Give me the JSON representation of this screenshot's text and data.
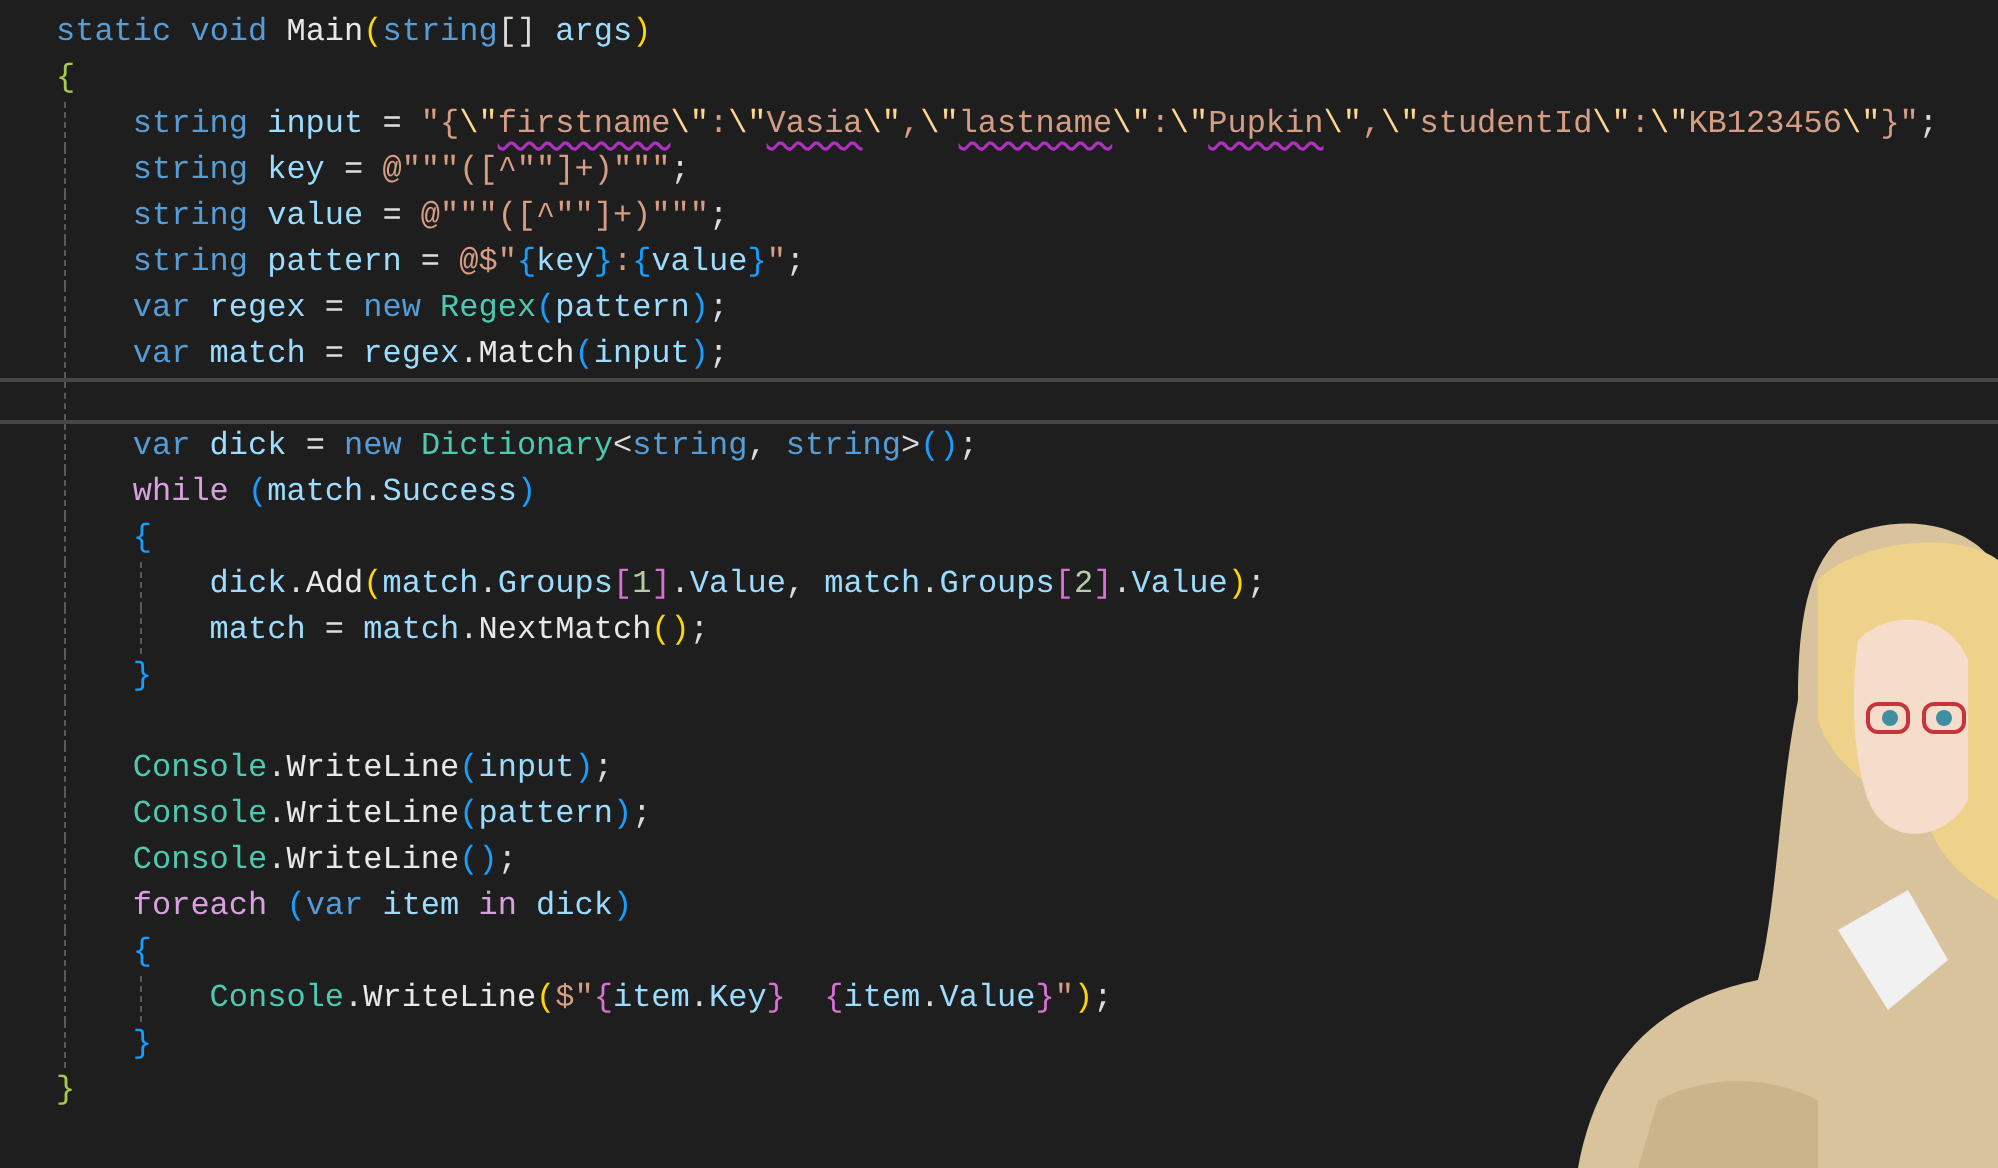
{
  "editor": {
    "code": [
      {
        "kind": "line",
        "current": false,
        "tokens": [
          {
            "text": "static",
            "kind": "kw"
          },
          {
            "text": " void",
            "kind": "kw"
          },
          {
            "text": " Main",
            "kind": "method"
          },
          {
            "text": "(",
            "kind": "b1"
          },
          {
            "text": "string",
            "kind": "kw"
          },
          {
            "text": "[]",
            "kind": "plain"
          },
          {
            "text": " args",
            "kind": "ident"
          },
          {
            "text": ")",
            "kind": "b1"
          }
        ]
      },
      {
        "kind": "line",
        "current": false,
        "tokens": [
          {
            "text": "{",
            "kind": "b0"
          }
        ]
      },
      {
        "kind": "block",
        "children": [
          {
            "kind": "line",
            "current": false,
            "tokens": [
              {
                "text": "string",
                "kind": "kw"
              },
              {
                "text": " input",
                "kind": "ident"
              },
              {
                "text": " = ",
                "kind": "plain"
              },
              {
                "text": "\"{",
                "kind": "str"
              },
              {
                "text": "\\\"",
                "kind": "esc"
              },
              {
                "text": "firstname",
                "kind": "str",
                "misspelled": true
              },
              {
                "text": "\\\"",
                "kind": "esc"
              },
              {
                "text": ":",
                "kind": "str"
              },
              {
                "text": "\\\"",
                "kind": "esc"
              },
              {
                "text": "Vasia",
                "kind": "str",
                "misspelled": true
              },
              {
                "text": "\\\"",
                "kind": "esc"
              },
              {
                "text": ",",
                "kind": "str"
              },
              {
                "text": "\\\"",
                "kind": "esc"
              },
              {
                "text": "lastname",
                "kind": "str",
                "misspelled": true
              },
              {
                "text": "\\\"",
                "kind": "esc"
              },
              {
                "text": ":",
                "kind": "str"
              },
              {
                "text": "\\\"",
                "kind": "esc"
              },
              {
                "text": "Pupkin",
                "kind": "str",
                "misspelled": true
              },
              {
                "text": "\\\"",
                "kind": "esc"
              },
              {
                "text": ",",
                "kind": "str"
              },
              {
                "text": "\\\"",
                "kind": "esc"
              },
              {
                "text": "studentId",
                "kind": "str"
              },
              {
                "text": "\\\"",
                "kind": "esc"
              },
              {
                "text": ":",
                "kind": "str"
              },
              {
                "text": "\\\"",
                "kind": "esc"
              },
              {
                "text": "KB123456",
                "kind": "str"
              },
              {
                "text": "\\\"",
                "kind": "esc"
              },
              {
                "text": "}\"",
                "kind": "str"
              },
              {
                "text": ";",
                "kind": "plain"
              }
            ]
          },
          {
            "kind": "line",
            "current": false,
            "tokens": [
              {
                "text": "string",
                "kind": "kw"
              },
              {
                "text": " key",
                "kind": "ident"
              },
              {
                "text": " = ",
                "kind": "plain"
              },
              {
                "text": "@\"\"\"([^\"\"]+)\"\"\"",
                "kind": "str"
              },
              {
                "text": ";",
                "kind": "plain"
              }
            ]
          },
          {
            "kind": "line",
            "current": false,
            "tokens": [
              {
                "text": "string",
                "kind": "kw"
              },
              {
                "text": " value",
                "kind": "ident"
              },
              {
                "text": " = ",
                "kind": "plain"
              },
              {
                "text": "@\"\"\"([^\"\"]+)\"\"\"",
                "kind": "str"
              },
              {
                "text": ";",
                "kind": "plain"
              }
            ]
          },
          {
            "kind": "line",
            "current": false,
            "tokens": [
              {
                "text": "string",
                "kind": "kw"
              },
              {
                "text": " pattern",
                "kind": "ident"
              },
              {
                "text": " = ",
                "kind": "plain"
              },
              {
                "text": "@$\"",
                "kind": "str"
              },
              {
                "text": "{",
                "kind": "b3"
              },
              {
                "text": "key",
                "kind": "ident"
              },
              {
                "text": "}",
                "kind": "b3"
              },
              {
                "text": ":",
                "kind": "str"
              },
              {
                "text": "{",
                "kind": "b3"
              },
              {
                "text": "value",
                "kind": "ident"
              },
              {
                "text": "}",
                "kind": "b3"
              },
              {
                "text": "\"",
                "kind": "str"
              },
              {
                "text": ";",
                "kind": "plain"
              }
            ]
          },
          {
            "kind": "line",
            "current": false,
            "tokens": [
              {
                "text": "var",
                "kind": "kw"
              },
              {
                "text": " regex",
                "kind": "ident"
              },
              {
                "text": " = ",
                "kind": "plain"
              },
              {
                "text": "new",
                "kind": "kw"
              },
              {
                "text": " Regex",
                "kind": "type"
              },
              {
                "text": "(",
                "kind": "b3"
              },
              {
                "text": "pattern",
                "kind": "ident"
              },
              {
                "text": ")",
                "kind": "b3"
              },
              {
                "text": ";",
                "kind": "plain"
              }
            ]
          },
          {
            "kind": "line",
            "current": false,
            "tokens": [
              {
                "text": "var",
                "kind": "kw"
              },
              {
                "text": " match",
                "kind": "ident"
              },
              {
                "text": " = ",
                "kind": "plain"
              },
              {
                "text": "regex",
                "kind": "ident"
              },
              {
                "text": ".",
                "kind": "plain"
              },
              {
                "text": "Match",
                "kind": "method"
              },
              {
                "text": "(",
                "kind": "b3"
              },
              {
                "text": "input",
                "kind": "ident"
              },
              {
                "text": ")",
                "kind": "b3"
              },
              {
                "text": ";",
                "kind": "plain"
              }
            ]
          },
          {
            "kind": "line",
            "current": true
          },
          {
            "kind": "line",
            "current": false,
            "tokens": [
              {
                "text": "var",
                "kind": "kw"
              },
              {
                "text": " dick",
                "kind": "ident"
              },
              {
                "text": " = ",
                "kind": "plain"
              },
              {
                "text": "new",
                "kind": "kw"
              },
              {
                "text": " Dictionary",
                "kind": "type"
              },
              {
                "text": "<",
                "kind": "plain"
              },
              {
                "text": "string",
                "kind": "kw"
              },
              {
                "text": ", ",
                "kind": "plain"
              },
              {
                "text": "string",
                "kind": "kw"
              },
              {
                "text": ">",
                "kind": "plain"
              },
              {
                "text": "()",
                "kind": "b3"
              },
              {
                "text": ";",
                "kind": "plain"
              }
            ]
          },
          {
            "kind": "line",
            "current": false,
            "tokens": [
              {
                "text": "while",
                "kind": "ctrl"
              },
              {
                "text": " (",
                "kind": "b3"
              },
              {
                "text": "match",
                "kind": "ident"
              },
              {
                "text": ".",
                "kind": "plain"
              },
              {
                "text": "Success",
                "kind": "ident"
              },
              {
                "text": ")",
                "kind": "b3"
              }
            ]
          },
          {
            "kind": "line",
            "current": false,
            "tokens": [
              {
                "text": "{",
                "kind": "b3"
              }
            ]
          },
          {
            "kind": "block",
            "children": [
              {
                "kind": "line",
                "current": false,
                "tokens": [
                  {
                    "text": "dick",
                    "kind": "ident"
                  },
                  {
                    "text": ".",
                    "kind": "plain"
                  },
                  {
                    "text": "Add",
                    "kind": "method"
                  },
                  {
                    "text": "(",
                    "kind": "b1"
                  },
                  {
                    "text": "match",
                    "kind": "ident"
                  },
                  {
                    "text": ".",
                    "kind": "plain"
                  },
                  {
                    "text": "Groups",
                    "kind": "ident"
                  },
                  {
                    "text": "[",
                    "kind": "b2"
                  },
                  {
                    "text": "1",
                    "kind": "num"
                  },
                  {
                    "text": "]",
                    "kind": "b2"
                  },
                  {
                    "text": ".",
                    "kind": "plain"
                  },
                  {
                    "text": "Value",
                    "kind": "ident"
                  },
                  {
                    "text": ", ",
                    "kind": "plain"
                  },
                  {
                    "text": "match",
                    "kind": "ident"
                  },
                  {
                    "text": ".",
                    "kind": "plain"
                  },
                  {
                    "text": "Groups",
                    "kind": "ident"
                  },
                  {
                    "text": "[",
                    "kind": "b2"
                  },
                  {
                    "text": "2",
                    "kind": "num"
                  },
                  {
                    "text": "]",
                    "kind": "b2"
                  },
                  {
                    "text": ".",
                    "kind": "plain"
                  },
                  {
                    "text": "Value",
                    "kind": "ident"
                  },
                  {
                    "text": ")",
                    "kind": "b1"
                  },
                  {
                    "text": ";",
                    "kind": "plain"
                  }
                ]
              },
              {
                "kind": "line",
                "current": false,
                "tokens": [
                  {
                    "text": "match",
                    "kind": "ident"
                  },
                  {
                    "text": " = ",
                    "kind": "plain"
                  },
                  {
                    "text": "match",
                    "kind": "ident"
                  },
                  {
                    "text": ".",
                    "kind": "plain"
                  },
                  {
                    "text": "NextMatch",
                    "kind": "method"
                  },
                  {
                    "text": "()",
                    "kind": "b1"
                  },
                  {
                    "text": ";",
                    "kind": "plain"
                  }
                ]
              }
            ]
          },
          {
            "kind": "line",
            "current": false,
            "tokens": [
              {
                "text": "}",
                "kind": "b3"
              }
            ]
          },
          {
            "kind": "line",
            "current": false
          },
          {
            "kind": "line",
            "current": false,
            "tokens": [
              {
                "text": "Console",
                "kind": "type"
              },
              {
                "text": ".",
                "kind": "plain"
              },
              {
                "text": "WriteLine",
                "kind": "method"
              },
              {
                "text": "(",
                "kind": "b3"
              },
              {
                "text": "input",
                "kind": "ident"
              },
              {
                "text": ")",
                "kind": "b3"
              },
              {
                "text": ";",
                "kind": "plain"
              }
            ]
          },
          {
            "kind": "line",
            "current": false,
            "tokens": [
              {
                "text": "Console",
                "kind": "type"
              },
              {
                "text": ".",
                "kind": "plain"
              },
              {
                "text": "WriteLine",
                "kind": "method"
              },
              {
                "text": "(",
                "kind": "b3"
              },
              {
                "text": "pattern",
                "kind": "ident"
              },
              {
                "text": ")",
                "kind": "b3"
              },
              {
                "text": ";",
                "kind": "plain"
              }
            ]
          },
          {
            "kind": "line",
            "current": false,
            "tokens": [
              {
                "text": "Console",
                "kind": "type"
              },
              {
                "text": ".",
                "kind": "plain"
              },
              {
                "text": "WriteLine",
                "kind": "method"
              },
              {
                "text": "()",
                "kind": "b3"
              },
              {
                "text": ";",
                "kind": "plain"
              }
            ]
          },
          {
            "kind": "line",
            "current": false,
            "tokens": [
              {
                "text": "foreach",
                "kind": "ctrl"
              },
              {
                "text": " (",
                "kind": "b3"
              },
              {
                "text": "var",
                "kind": "kw"
              },
              {
                "text": " item",
                "kind": "ident"
              },
              {
                "text": " in",
                "kind": "ctrl"
              },
              {
                "text": " dick",
                "kind": "ident"
              },
              {
                "text": ")",
                "kind": "b3"
              }
            ]
          },
          {
            "kind": "line",
            "current": false,
            "tokens": [
              {
                "text": "{",
                "kind": "b3"
              }
            ]
          },
          {
            "kind": "block",
            "children": [
              {
                "kind": "line",
                "current": false,
                "tokens": [
                  {
                    "text": "Console",
                    "kind": "type"
                  },
                  {
                    "text": ".",
                    "kind": "plain"
                  },
                  {
                    "text": "WriteLine",
                    "kind": "method"
                  },
                  {
                    "text": "(",
                    "kind": "b1"
                  },
                  {
                    "text": "$\"",
                    "kind": "str"
                  },
                  {
                    "text": "{",
                    "kind": "b2"
                  },
                  {
                    "text": "item",
                    "kind": "ident"
                  },
                  {
                    "text": ".",
                    "kind": "plain"
                  },
                  {
                    "text": "Key",
                    "kind": "ident"
                  },
                  {
                    "text": "}  ",
                    "kind": "b2"
                  },
                  {
                    "text": "{",
                    "kind": "b2"
                  },
                  {
                    "text": "item",
                    "kind": "ident"
                  },
                  {
                    "text": ".",
                    "kind": "plain"
                  },
                  {
                    "text": "Value",
                    "kind": "ident"
                  },
                  {
                    "text": "}",
                    "kind": "b2"
                  },
                  {
                    "text": "\"",
                    "kind": "str"
                  },
                  {
                    "text": ")",
                    "kind": "b1"
                  },
                  {
                    "text": ";",
                    "kind": "plain"
                  }
                ]
              }
            ]
          },
          {
            "kind": "line",
            "current": false,
            "tokens": [
              {
                "text": "}",
                "kind": "b3"
              }
            ]
          }
        ]
      },
      {
        "kind": "line",
        "current": false,
        "tokens": [
          {
            "text": "}",
            "kind": "b0"
          }
        ]
      }
    ]
  }
}
